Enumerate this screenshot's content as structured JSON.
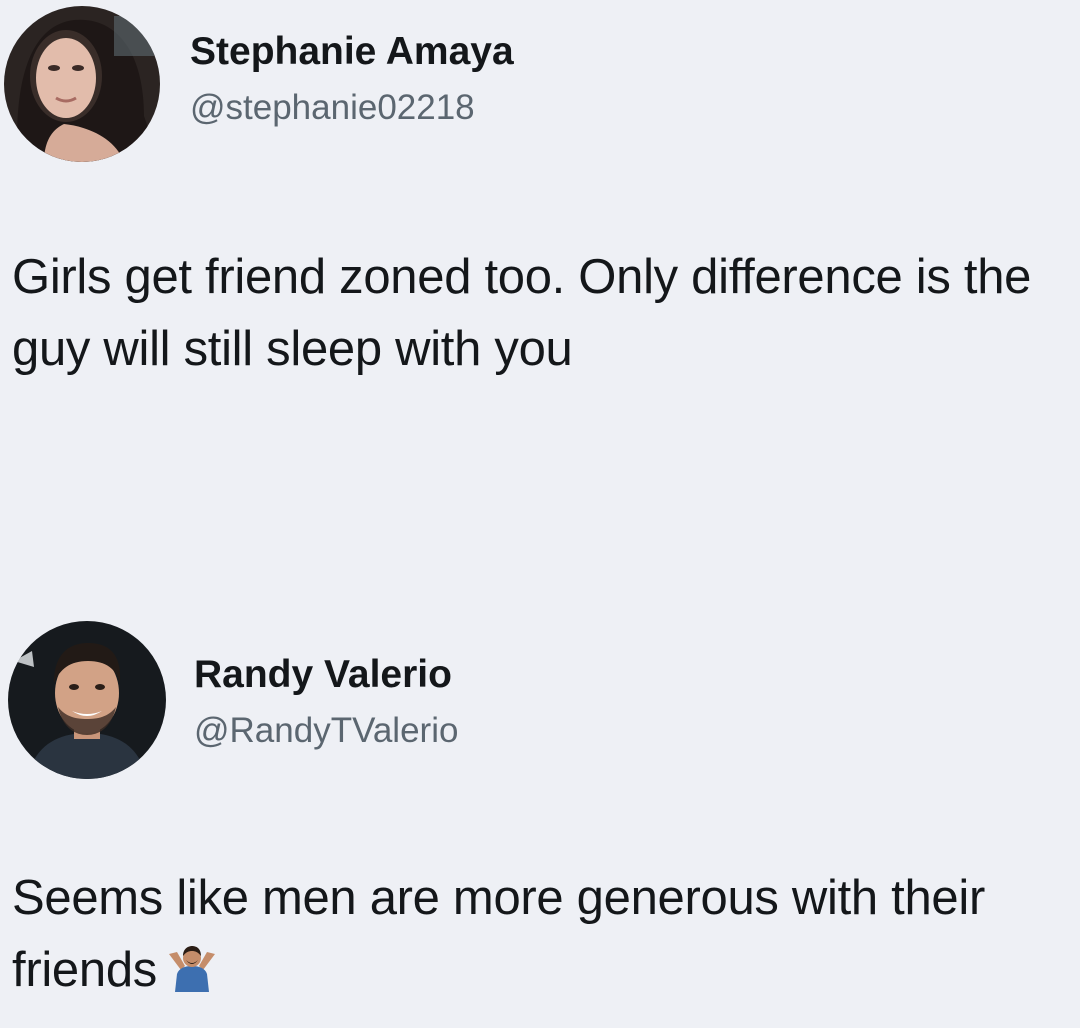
{
  "tweets": [
    {
      "name": "Stephanie Amaya",
      "handle": "@stephanie02218",
      "text": "Girls get friend zoned too. Only difference is the guy will still sleep with you",
      "avatar": "profile-photo-woman"
    },
    {
      "name": "Randy Valerio",
      "handle": "@RandyTValerio",
      "text": "Seems like men are more generous with their friends",
      "emoji": "man-shrugging-emoji",
      "avatar": "profile-photo-man"
    }
  ],
  "colors": {
    "background": "#eef0f5",
    "text": "#14171a",
    "handle": "#5b6670"
  }
}
